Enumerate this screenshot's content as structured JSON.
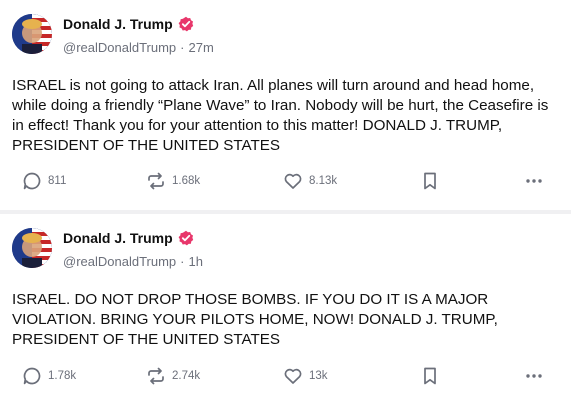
{
  "posts": [
    {
      "author": {
        "name": "Donald J. Trump",
        "handle": "@realDonaldTrump",
        "separator": "·",
        "time": "27m"
      },
      "text": "ISRAEL is not going to attack Iran. All planes will turn around and head home, while doing a friendly “Plane Wave” to Iran. Nobody will be hurt, the Ceasefire is in effect! Thank you for your attention to this matter! DONALD J. TRUMP, PRESIDENT OF THE UNITED STATES",
      "stats": {
        "replies": "811",
        "retruths": "1.68k",
        "likes": "8.13k"
      }
    },
    {
      "author": {
        "name": "Donald J. Trump",
        "handle": "@realDonaldTrump",
        "separator": "·",
        "time": "1h"
      },
      "text": "ISRAEL. DO NOT DROP THOSE BOMBS. IF YOU DO IT IS A MAJOR VIOLATION. BRING YOUR PILOTS HOME, NOW!  DONALD J. TRUMP, PRESIDENT OF THE UNITED STATES",
      "stats": {
        "replies": "1.78k",
        "retruths": "2.74k",
        "likes": "13k"
      }
    }
  ],
  "icons": {
    "verified": "verified-badge-icon",
    "reply": "reply-bubble-icon",
    "retruth": "retruth-arrows-icon",
    "like": "heart-icon",
    "bookmark": "bookmark-icon",
    "more": "more-dots-icon"
  },
  "colors": {
    "verified_badge": "#e8376b",
    "icon_gray": "#6b6f7a",
    "text": "#111111",
    "divider": "#f0f0f2"
  }
}
